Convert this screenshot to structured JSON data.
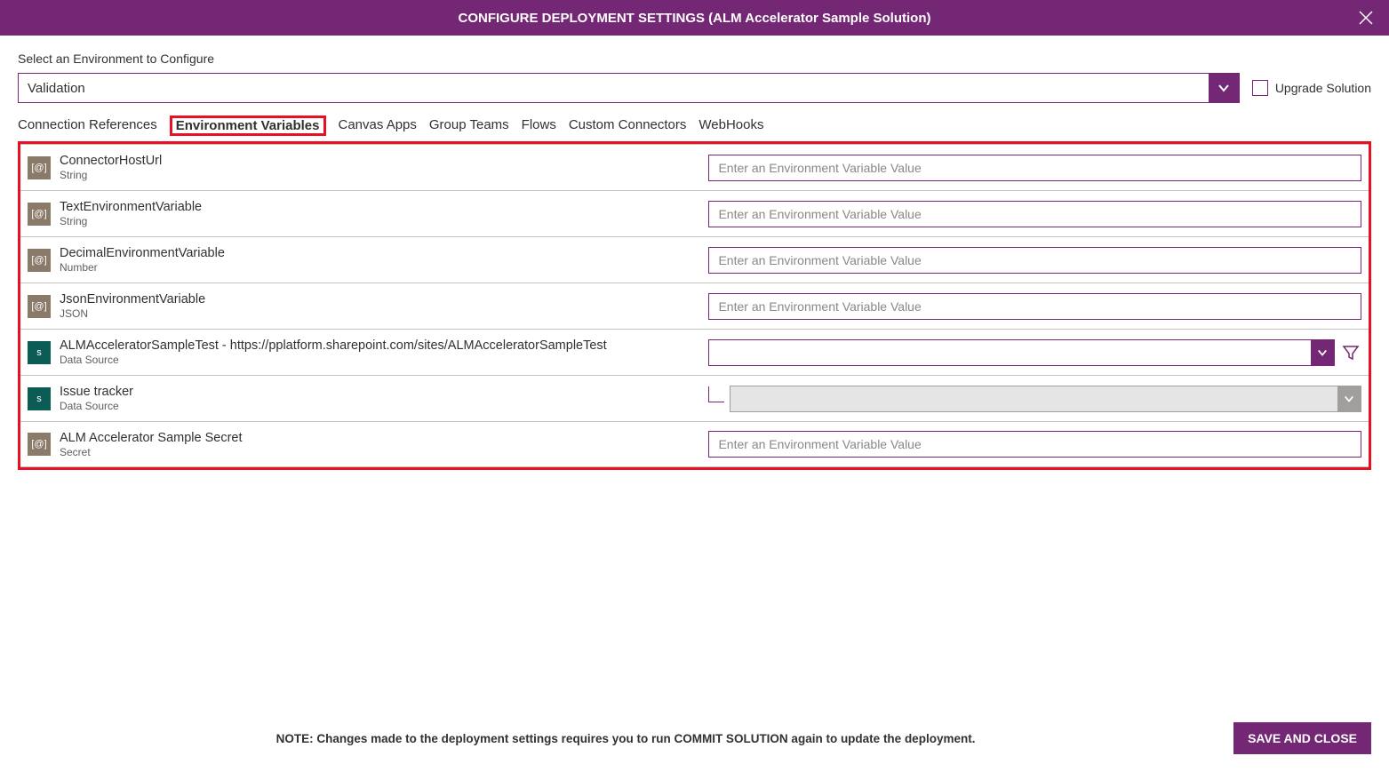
{
  "header": {
    "title": "CONFIGURE DEPLOYMENT SETTINGS (ALM Accelerator Sample Solution)"
  },
  "envSelect": {
    "label": "Select an Environment to Configure",
    "value": "Validation"
  },
  "upgrade": {
    "label": "Upgrade Solution"
  },
  "tabs": [
    {
      "label": "Connection References",
      "active": false
    },
    {
      "label": "Environment Variables",
      "active": true
    },
    {
      "label": "Canvas Apps",
      "active": false
    },
    {
      "label": "Group Teams",
      "active": false
    },
    {
      "label": "Flows",
      "active": false
    },
    {
      "label": "Custom Connectors",
      "active": false
    },
    {
      "label": "WebHooks",
      "active": false
    }
  ],
  "vars": [
    {
      "icon": "brown",
      "glyph": "[@]",
      "name": "ConnectorHostUrl",
      "type": "String",
      "input": "text",
      "placeholder": "Enter an Environment Variable Value"
    },
    {
      "icon": "brown",
      "glyph": "[@]",
      "name": "TextEnvironmentVariable",
      "type": "String",
      "input": "text",
      "placeholder": "Enter an Environment Variable Value"
    },
    {
      "icon": "brown",
      "glyph": "[@]",
      "name": "DecimalEnvironmentVariable",
      "type": "Number",
      "input": "text",
      "placeholder": "Enter an Environment Variable Value"
    },
    {
      "icon": "brown",
      "glyph": "[@]",
      "name": "JsonEnvironmentVariable",
      "type": "JSON",
      "input": "text",
      "placeholder": "Enter an Environment Variable Value"
    },
    {
      "icon": "teal",
      "glyph": "s",
      "name": "ALMAcceleratorSampleTest - https://pplatform.sharepoint.com/sites/ALMAcceleratorSampleTest",
      "type": "Data Source",
      "input": "dsselect",
      "filter": true
    },
    {
      "icon": "teal",
      "glyph": "s",
      "name": "Issue tracker",
      "type": "Data Source",
      "input": "dsselect-disabled",
      "tree": true
    },
    {
      "icon": "brown",
      "glyph": "[@]",
      "name": "ALM Accelerator Sample Secret",
      "type": "Secret",
      "input": "text",
      "placeholder": "Enter an Environment Variable Value"
    }
  ],
  "footer": {
    "note": "NOTE: Changes made to the deployment settings requires you to run COMMIT SOLUTION again to update the deployment.",
    "saveLabel": "SAVE AND CLOSE"
  }
}
